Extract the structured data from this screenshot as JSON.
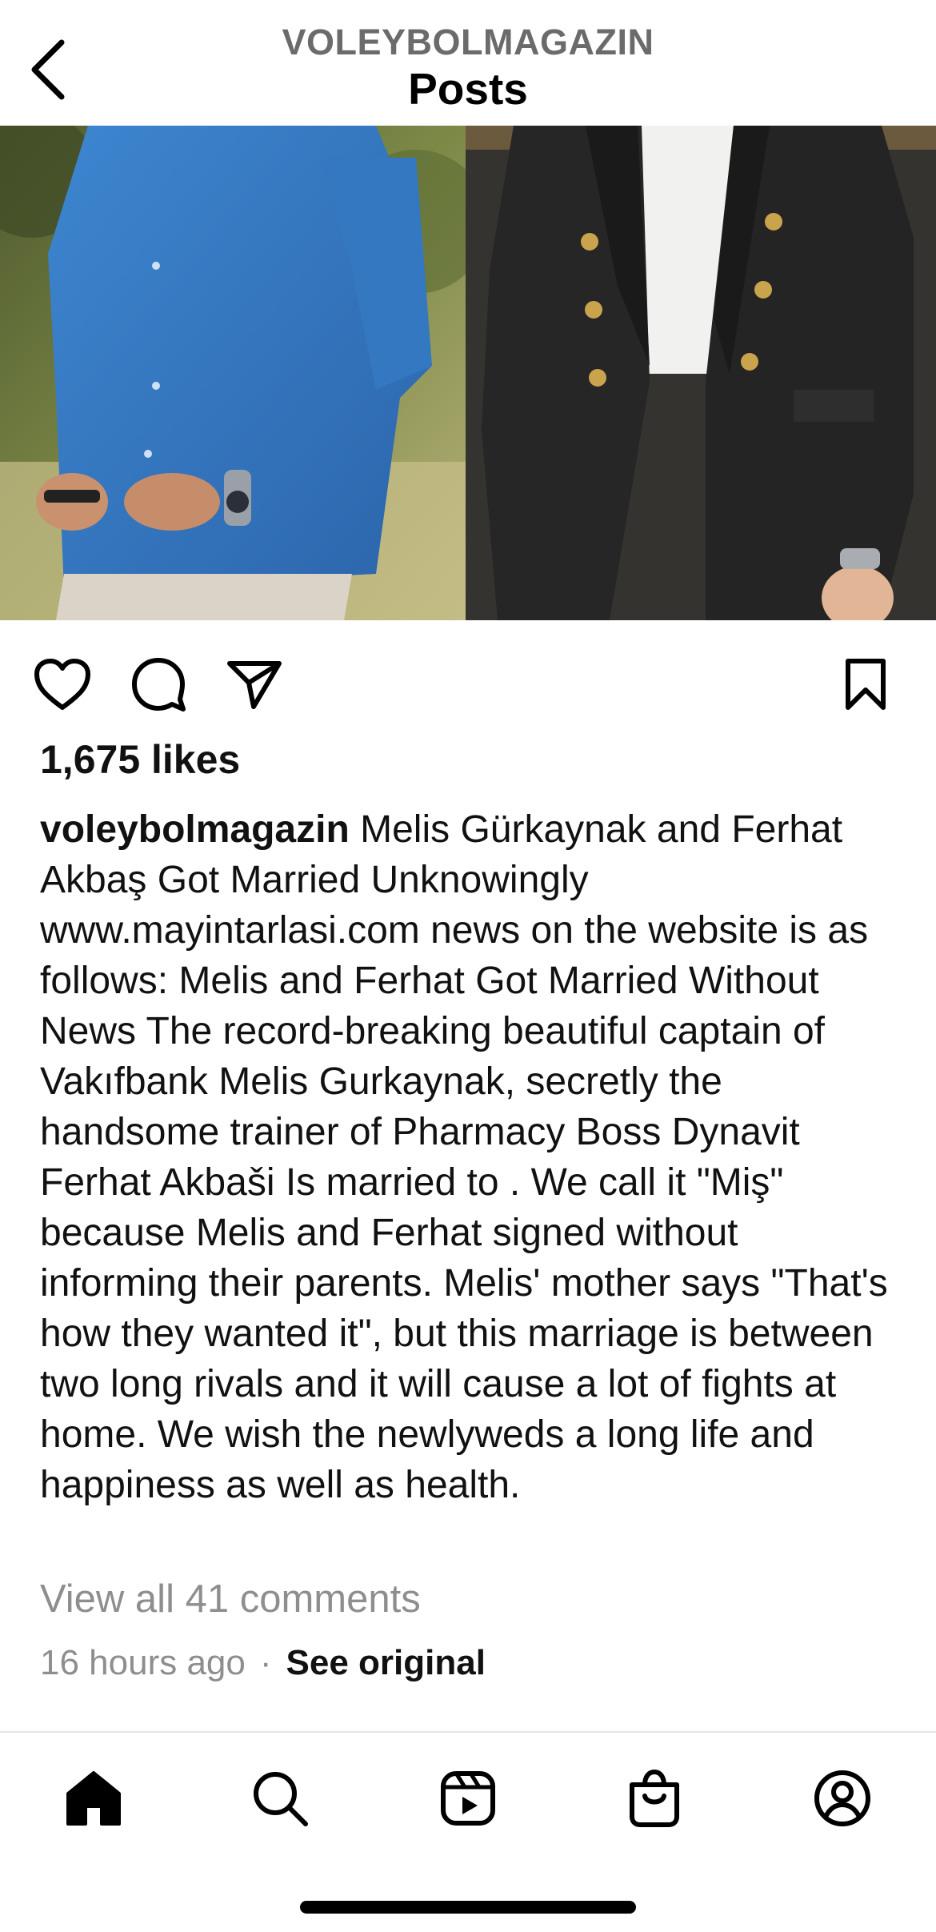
{
  "header": {
    "account": "VOLEYBOLMAGAZIN",
    "title": "Posts"
  },
  "post": {
    "likes": "1,675 likes",
    "username": "voleybolmagazin",
    "caption": "Melis Gürkaynak and Ferhat Akbaş Got Married Unknowingly www.mayintarlasi.com news on the website is as follows: Melis and Ferhat Got Married Without News The record-breaking beautiful captain of Vakıfbank Melis Gurkaynak, secretly the handsome trainer of Pharmacy Boss Dynavit Ferhat Akbaši Is married to . We call it \"Miş\" because Melis and Ferhat signed without informing their parents. Melis' mother says \"That's how they wanted it\", but this marriage is between two long rivals and it will cause a lot of fights at home. We wish the newlyweds a long life and happiness as well as health.",
    "view_comments": "View all 41 comments",
    "time": "16 hours ago",
    "dot": "·",
    "see_original": "See original"
  },
  "icons": {
    "back": "chevron-left-icon",
    "like": "heart-icon",
    "comment": "comment-icon",
    "share": "paper-plane-icon",
    "save": "bookmark-icon",
    "home": "home-icon",
    "search": "search-icon",
    "reels": "reels-icon",
    "shop": "shopping-bag-icon",
    "profile": "profile-icon"
  }
}
